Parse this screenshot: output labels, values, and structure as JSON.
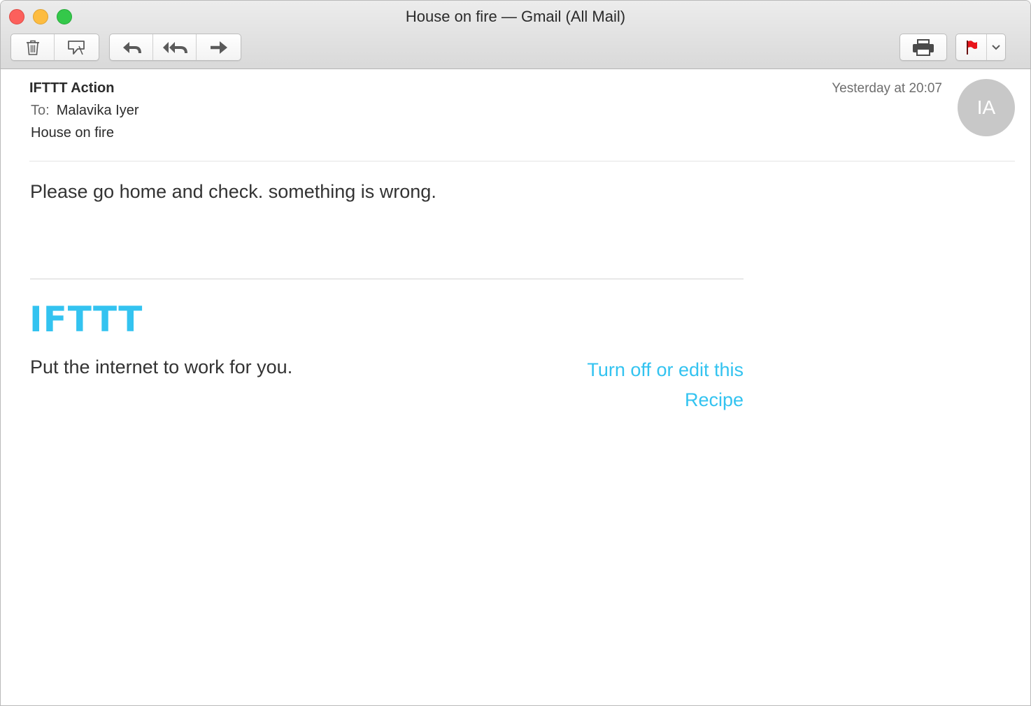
{
  "window": {
    "title": "House on fire — Gmail (All Mail)"
  },
  "toolbar": {
    "buttons": [
      {
        "name": "trash-icon"
      },
      {
        "name": "junk-icon"
      },
      {
        "name": "reply-icon"
      },
      {
        "name": "reply-all-icon"
      },
      {
        "name": "forward-icon"
      },
      {
        "name": "print-icon"
      },
      {
        "name": "flag-icon"
      },
      {
        "name": "chevron-down-icon"
      }
    ]
  },
  "email": {
    "from": "IFTTT Action",
    "to_label": "To:",
    "to": "Malavika Iyer",
    "subject": "House on fire",
    "date": "Yesterday at 20:07",
    "avatar_initials": "IA",
    "body": "Please go home and check. something is wrong."
  },
  "footer": {
    "logo": "IFTTT",
    "tagline": "Put the internet to work for you.",
    "link": "Turn off or edit this Recipe"
  },
  "colors": {
    "accent": "#33c3f0",
    "flag": "#e8151b",
    "avatar": "#c8c8c8"
  }
}
